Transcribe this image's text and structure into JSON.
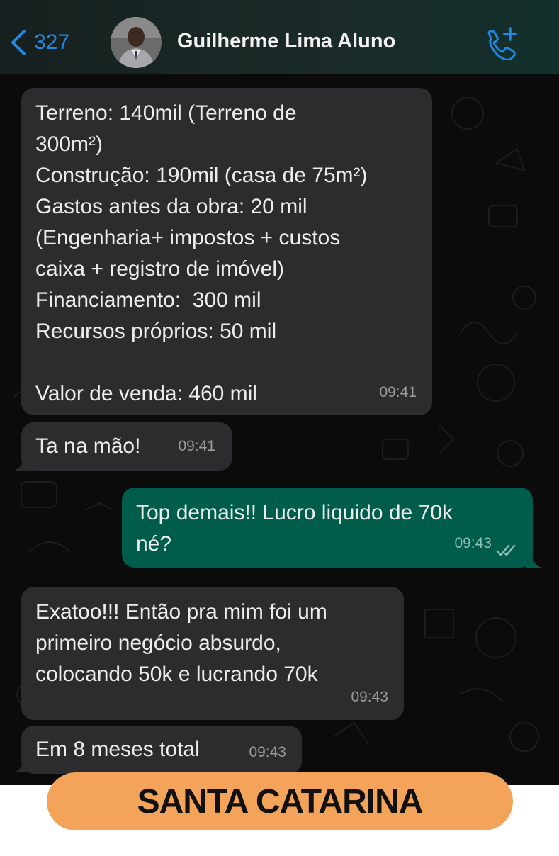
{
  "header": {
    "back_count": "327",
    "contact_name": "Guilherme Lima Aluno",
    "icons": {
      "back": "chevron-left-icon",
      "call": "add-call-icon",
      "avatar": "contact-avatar"
    }
  },
  "messages": [
    {
      "direction": "incoming",
      "text": "Terreno: 140mil (Terreno de\n300m²)\nConstrução: 190mil (casa de 75m²)\nGastos antes da obra: 20 mil\n(Engenharia+ impostos + custos\ncaixa + registro de imóvel)\nFinanciamento:  300 mil\nRecursos próprios: 50 mil\n\nValor de venda: 460 mil",
      "time": "09:41"
    },
    {
      "direction": "incoming",
      "text": "Ta na mão!",
      "time": "09:41"
    },
    {
      "direction": "outgoing",
      "text": "Top demais!! Lucro liquido de 70k\nné?",
      "time": "09:43",
      "status": "read"
    },
    {
      "direction": "incoming",
      "text": "Exatoo!!! Então pra mim foi um\nprimeiro negócio absurdo,\ncolocando 50k e lucrando 70k",
      "time": "09:43"
    },
    {
      "direction": "incoming",
      "text": "Em 8 meses total",
      "time": "09:43"
    }
  ],
  "banner": {
    "label": "SANTA CATARINA"
  },
  "colors": {
    "background": "#0b0b0b",
    "incoming_bubble": "#2c2c2e",
    "outgoing_bubble": "#005c4b",
    "accent_blue": "#1e88e5",
    "banner": "#f4a35a"
  }
}
